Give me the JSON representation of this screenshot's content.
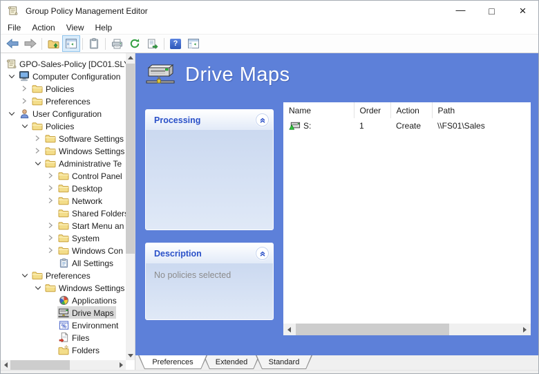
{
  "window": {
    "title": "Group Policy Management Editor",
    "controls": {
      "minimize": "—",
      "maximize": "□",
      "close": "×"
    }
  },
  "menu": {
    "items": [
      "File",
      "Action",
      "View",
      "Help"
    ]
  },
  "toolbar": {
    "buttons": [
      {
        "id": "back",
        "icon": "arrow-left"
      },
      {
        "id": "forward",
        "icon": "arrow-right"
      },
      {
        "sep": true
      },
      {
        "id": "up-one-level",
        "icon": "folder-up"
      },
      {
        "id": "console-tree",
        "icon": "console-window",
        "toggled": true
      },
      {
        "sep": true
      },
      {
        "id": "clipboard",
        "icon": "clipboard"
      },
      {
        "sep": true
      },
      {
        "id": "print",
        "icon": "printer"
      },
      {
        "id": "refresh",
        "icon": "refresh"
      },
      {
        "id": "export-list",
        "icon": "export-list"
      },
      {
        "sep": true
      },
      {
        "id": "help",
        "icon": "help"
      },
      {
        "id": "action-pane",
        "icon": "action-pane"
      }
    ]
  },
  "tree": {
    "items": [
      {
        "label": "GPO-Sales-Policy [DC01.SLY",
        "level": 0,
        "expander": "none",
        "icon": "gpo"
      },
      {
        "label": "Computer Configuration",
        "level": 1,
        "expander": "open",
        "icon": "computer"
      },
      {
        "label": "Policies",
        "level": 2,
        "expander": "closed",
        "icon": "folder"
      },
      {
        "label": "Preferences",
        "level": 2,
        "expander": "closed",
        "icon": "folder"
      },
      {
        "label": "User Configuration",
        "level": 1,
        "expander": "open",
        "icon": "user"
      },
      {
        "label": "Policies",
        "level": 2,
        "expander": "open",
        "icon": "folder"
      },
      {
        "label": "Software Settings",
        "level": 3,
        "expander": "closed",
        "icon": "folder"
      },
      {
        "label": "Windows Settings",
        "level": 3,
        "expander": "closed",
        "icon": "folder"
      },
      {
        "label": "Administrative Te",
        "level": 3,
        "expander": "open",
        "icon": "folder"
      },
      {
        "label": "Control Panel",
        "level": 4,
        "expander": "closed",
        "icon": "folder"
      },
      {
        "label": "Desktop",
        "level": 4,
        "expander": "closed",
        "icon": "folder"
      },
      {
        "label": "Network",
        "level": 4,
        "expander": "closed",
        "icon": "folder"
      },
      {
        "label": "Shared Folders",
        "level": 4,
        "expander": "none",
        "icon": "folder"
      },
      {
        "label": "Start Menu an",
        "level": 4,
        "expander": "closed",
        "icon": "folder"
      },
      {
        "label": "System",
        "level": 4,
        "expander": "closed",
        "icon": "folder"
      },
      {
        "label": "Windows Con",
        "level": 4,
        "expander": "closed",
        "icon": "folder"
      },
      {
        "label": "All Settings",
        "level": 4,
        "expander": "none",
        "icon": "all-settings"
      },
      {
        "label": "Preferences",
        "level": 2,
        "expander": "open",
        "icon": "folder"
      },
      {
        "label": "Windows Settings",
        "level": 3,
        "expander": "open",
        "icon": "folder"
      },
      {
        "label": "Applications",
        "level": 4,
        "expander": "none",
        "icon": "applications"
      },
      {
        "label": "Drive Maps",
        "level": 4,
        "expander": "none",
        "icon": "drive-maps",
        "selected": true
      },
      {
        "label": "Environment",
        "level": 4,
        "expander": "none",
        "icon": "environment"
      },
      {
        "label": "Files",
        "level": 4,
        "expander": "none",
        "icon": "files"
      },
      {
        "label": "Folders",
        "level": 4,
        "expander": "none",
        "icon": "folders-new"
      }
    ]
  },
  "rightPane": {
    "title": "Drive Maps",
    "panels": [
      {
        "title": "Processing",
        "body": ""
      },
      {
        "title": "Description",
        "body": "No policies selected"
      }
    ],
    "table": {
      "columns": [
        "Name",
        "Order",
        "Action",
        "Path"
      ],
      "rows": [
        [
          "S:",
          "1",
          "Create",
          "\\\\FS01\\Sales"
        ]
      ]
    }
  },
  "tabs": {
    "items": [
      "Preferences",
      "Extended",
      "Standard"
    ],
    "active": 0
  },
  "colors": {
    "paneBlue": "#5d80d9",
    "panelTitleBlue": "#2a50c8",
    "treeSelection": "#d9d9d9",
    "toolbarToggle": "#d9ecfb"
  }
}
